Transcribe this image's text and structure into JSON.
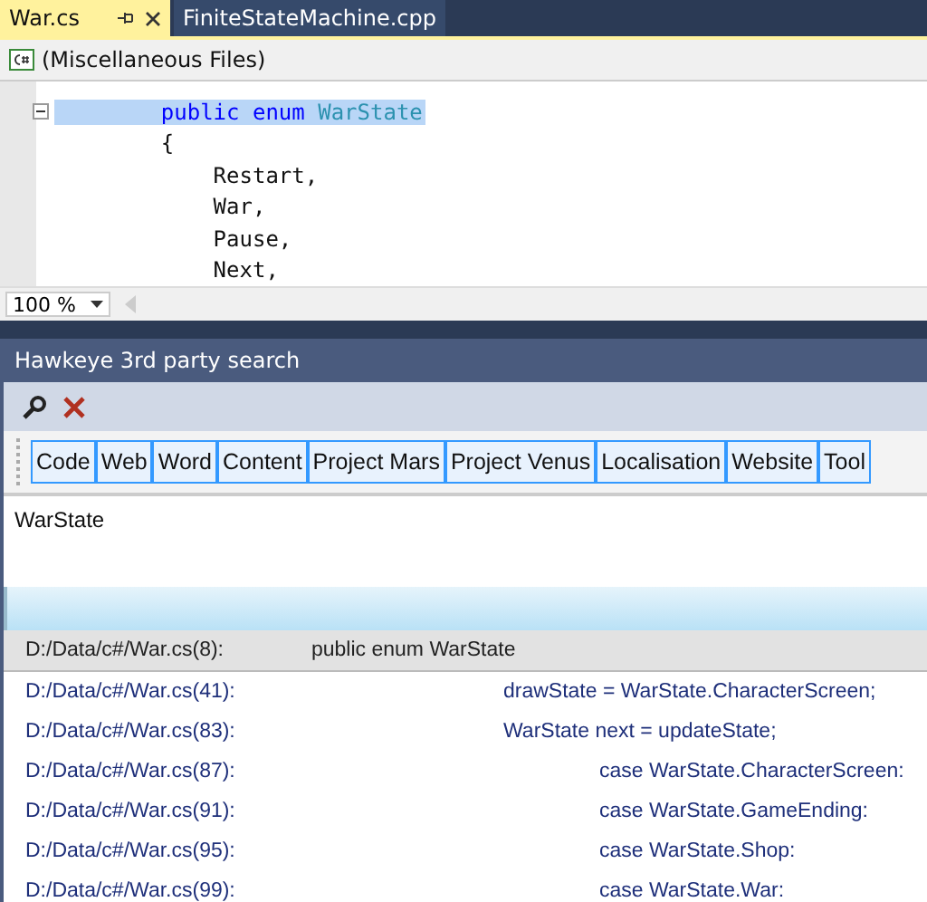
{
  "tabs": [
    {
      "label": "War.cs",
      "selected": true
    },
    {
      "label": "FiniteStateMachine.cpp",
      "selected": false
    }
  ],
  "navigation": {
    "label": "(Miscellaneous Files)"
  },
  "code_lines": [
    {
      "text": "public enum WarState",
      "kind": "declaration",
      "collapsible": true,
      "selected": true
    },
    {
      "text": "    {",
      "kind": "plain",
      "collapsible": false,
      "selected": false
    },
    {
      "text": "        Restart,",
      "kind": "plain",
      "collapsible": false,
      "selected": false
    },
    {
      "text": "        War,",
      "kind": "plain",
      "collapsible": false,
      "selected": false
    },
    {
      "text": "        Pause,",
      "kind": "plain",
      "collapsible": false,
      "selected": false
    },
    {
      "text": "        Next,",
      "kind": "plain",
      "collapsible": false,
      "selected": false
    }
  ],
  "zoom": {
    "value": "100 %"
  },
  "panel": {
    "title": "Hawkeye 3rd party search",
    "filters": [
      "Code",
      "Web",
      "Word",
      "Content",
      "Project Mars",
      "Project Venus",
      "Localisation",
      "Website",
      "Tool"
    ],
    "query": "WarState",
    "results": [
      {
        "location": "D:/Data/c#/War.cs(8):",
        "code": "public enum WarState",
        "selected": true
      },
      {
        "location": "D:/Data/c#/War.cs(41):",
        "code": "\t\tdrawState = WarState.CharacterScreen;",
        "selected": false
      },
      {
        "location": "D:/Data/c#/War.cs(83):",
        "code": "\t\tWarState next = updateState;",
        "selected": false
      },
      {
        "location": "D:/Data/c#/War.cs(87):",
        "code": "\t\t\tcase WarState.CharacterScreen:",
        "selected": false
      },
      {
        "location": "D:/Data/c#/War.cs(91):",
        "code": "\t\t\tcase WarState.GameEnding:",
        "selected": false
      },
      {
        "location": "D:/Data/c#/War.cs(95):",
        "code": "\t\t\tcase WarState.Shop:",
        "selected": false
      },
      {
        "location": "D:/Data/c#/War.cs(99):",
        "code": "\t\t\tcase WarState.War:",
        "selected": false
      }
    ]
  }
}
